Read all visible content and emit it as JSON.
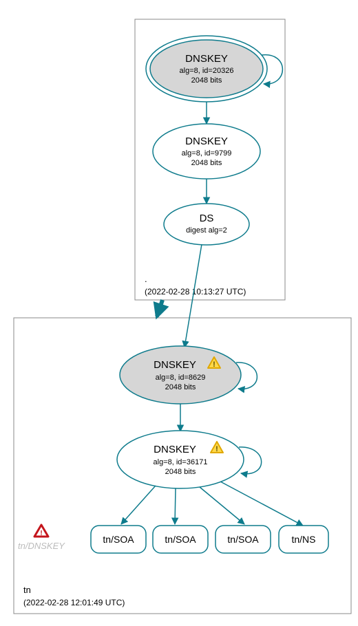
{
  "zones": {
    "root": {
      "label": ".",
      "timestamp": "(2022-02-28 10:13:27 UTC)"
    },
    "tn": {
      "label": "tn",
      "timestamp": "(2022-02-28 12:01:49 UTC)"
    }
  },
  "nodes": {
    "root_ksk": {
      "title": "DNSKEY",
      "line2": "alg=8, id=20326",
      "line3": "2048 bits"
    },
    "root_zsk": {
      "title": "DNSKEY",
      "line2": "alg=8, id=9799",
      "line3": "2048 bits"
    },
    "root_ds": {
      "title": "DS",
      "line2": "digest alg=2"
    },
    "tn_ksk": {
      "title": "DNSKEY",
      "line2": "alg=8, id=8629",
      "line3": "2048 bits"
    },
    "tn_zsk": {
      "title": "DNSKEY",
      "line2": "alg=8, id=36171",
      "line3": "2048 bits"
    },
    "tn_rr1": {
      "label": "tn/SOA"
    },
    "tn_rr2": {
      "label": "tn/SOA"
    },
    "tn_rr3": {
      "label": "tn/SOA"
    },
    "tn_rr4": {
      "label": "tn/NS"
    },
    "tn_missing": {
      "label": "tn/DNSKEY"
    }
  },
  "chart_data": {
    "type": "graph",
    "description": "DNSSEC authentication chain (DNSViz-style) for zone 'tn' delegated from root '.'",
    "zones": [
      {
        "name": ".",
        "timestamp_utc": "2022-02-28 10:13:27"
      },
      {
        "name": "tn",
        "timestamp_utc": "2022-02-28 12:01:49"
      }
    ],
    "nodes": [
      {
        "id": "root_ksk",
        "zone": ".",
        "type": "DNSKEY",
        "alg": 8,
        "key_id": 20326,
        "bits": 2048,
        "sep": true,
        "status": "secure"
      },
      {
        "id": "root_zsk",
        "zone": ".",
        "type": "DNSKEY",
        "alg": 8,
        "key_id": 9799,
        "bits": 2048,
        "sep": false,
        "status": "secure"
      },
      {
        "id": "root_ds",
        "zone": ".",
        "type": "DS",
        "digest_alg": 2,
        "status": "secure"
      },
      {
        "id": "tn_ksk",
        "zone": "tn",
        "type": "DNSKEY",
        "alg": 8,
        "key_id": 8629,
        "bits": 2048,
        "sep": true,
        "status": "warning"
      },
      {
        "id": "tn_zsk",
        "zone": "tn",
        "type": "DNSKEY",
        "alg": 8,
        "key_id": 36171,
        "bits": 2048,
        "sep": false,
        "status": "warning"
      },
      {
        "id": "tn_soa_1",
        "zone": "tn",
        "type": "RRset",
        "name": "tn/SOA"
      },
      {
        "id": "tn_soa_2",
        "zone": "tn",
        "type": "RRset",
        "name": "tn/SOA"
      },
      {
        "id": "tn_soa_3",
        "zone": "tn",
        "type": "RRset",
        "name": "tn/SOA"
      },
      {
        "id": "tn_ns",
        "zone": "tn",
        "type": "RRset",
        "name": "tn/NS"
      },
      {
        "id": "tn_dnskey_missing",
        "zone": "tn",
        "type": "RRset",
        "name": "tn/DNSKEY",
        "status": "error",
        "missing": true
      }
    ],
    "edges": [
      {
        "from": "root_ksk",
        "to": "root_ksk",
        "kind": "self-sign"
      },
      {
        "from": "root_ksk",
        "to": "root_zsk",
        "kind": "signs"
      },
      {
        "from": "root_zsk",
        "to": "root_ds",
        "kind": "signs"
      },
      {
        "from": "root_ds",
        "to": "tn_ksk",
        "kind": "delegation"
      },
      {
        "from": "root",
        "to": "tn",
        "kind": "zone-delegation"
      },
      {
        "from": "tn_ksk",
        "to": "tn_ksk",
        "kind": "self-sign"
      },
      {
        "from": "tn_ksk",
        "to": "tn_zsk",
        "kind": "signs"
      },
      {
        "from": "tn_zsk",
        "to": "tn_zsk",
        "kind": "self-sign"
      },
      {
        "from": "tn_zsk",
        "to": "tn_soa_1",
        "kind": "signs"
      },
      {
        "from": "tn_zsk",
        "to": "tn_soa_2",
        "kind": "signs"
      },
      {
        "from": "tn_zsk",
        "to": "tn_soa_3",
        "kind": "signs"
      },
      {
        "from": "tn_zsk",
        "to": "tn_ns",
        "kind": "signs"
      }
    ]
  }
}
